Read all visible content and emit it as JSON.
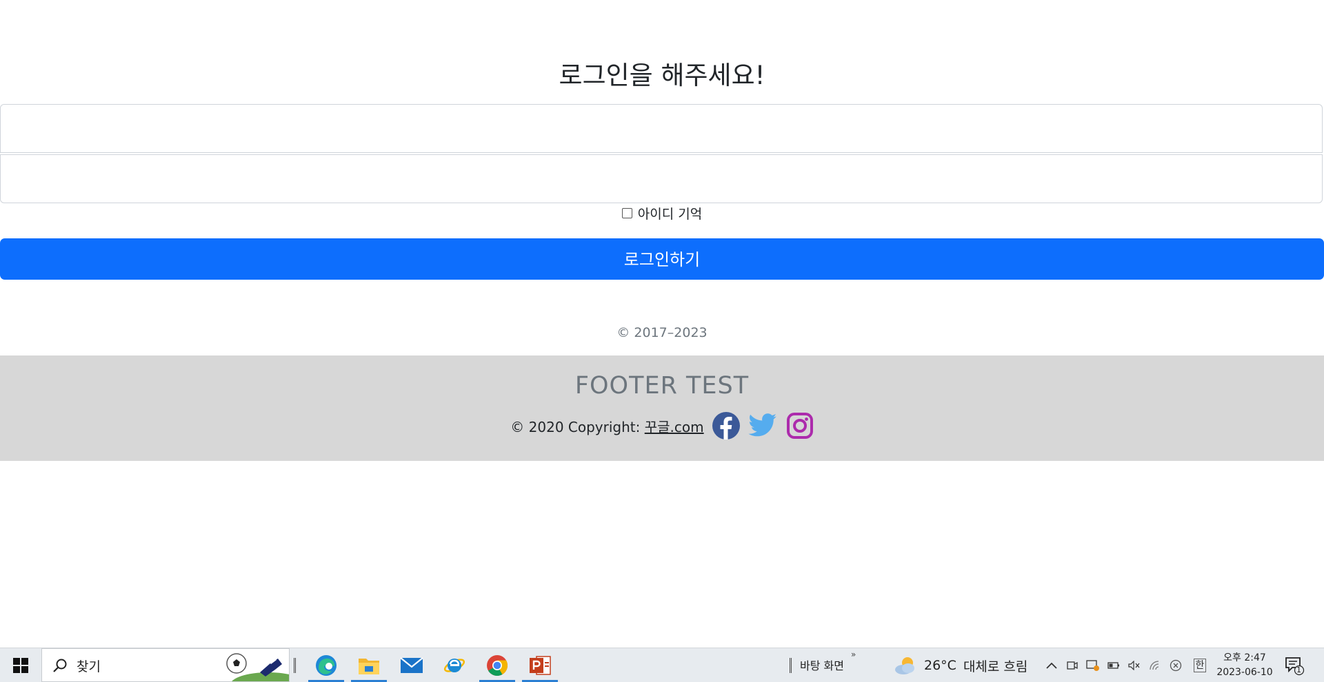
{
  "signin": {
    "title": "로그인을 해주세요!",
    "id_placeholder": "",
    "pw_placeholder": "",
    "remember_label": "아이디 기억",
    "remember_checked": false,
    "submit_label": "로그인하기",
    "copyright": "© 2017–2023"
  },
  "footer": {
    "title": "FOOTER TEST",
    "copyright_prefix": "© 2020 Copyright: ",
    "link_text": "꾸글.com",
    "social": [
      "facebook-icon",
      "twitter-icon",
      "instagram-icon"
    ],
    "colors": {
      "background": "#d7d7d7",
      "facebook": "#3b5998",
      "twitter": "#55acee",
      "instagram": "#ac2bac"
    }
  },
  "colors": {
    "primary": "#0d6efd",
    "muted": "#6c757d"
  },
  "taskbar": {
    "search_placeholder": "찾기",
    "apps": [
      "edge-icon",
      "file-explorer-icon",
      "mail-icon",
      "internet-explorer-icon",
      "chrome-icon",
      "powerpoint-icon"
    ],
    "desktop_label": "바탕 화면",
    "desktop_chevron": "»",
    "weather_temp": "26°C",
    "weather_desc": "대체로 흐림",
    "ime_label": "한",
    "clock_time": "오후 2:47",
    "clock_date": "2023-06-10",
    "notification_count": "1"
  }
}
